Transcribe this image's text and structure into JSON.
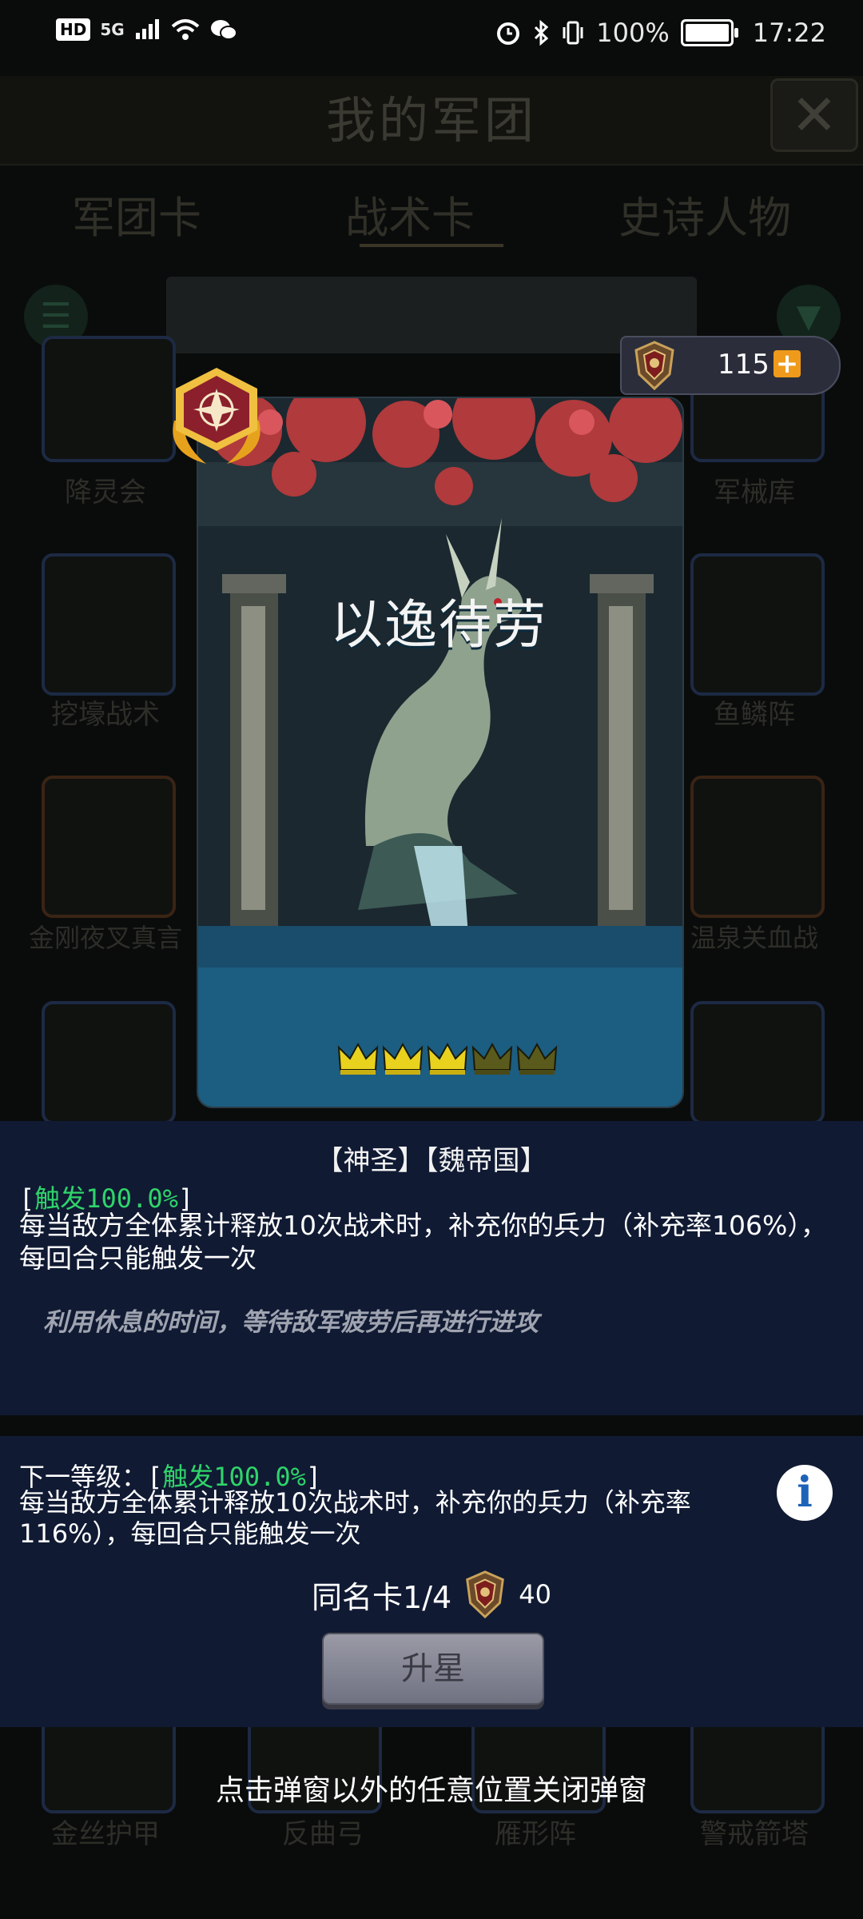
{
  "status_bar": {
    "hd": "HD",
    "network": "5G",
    "battery_pct": "100%",
    "battery_level": 1.0,
    "time": "17:22"
  },
  "background": {
    "title": "我的军团",
    "tabs": [
      "军团卡",
      "战术卡",
      "史诗人物"
    ],
    "labels": [
      "降灵会",
      "军械库",
      "挖壕战术",
      "鱼鳞阵",
      "金刚夜叉真言",
      "温泉关血战",
      "金丝护甲",
      "反曲弓",
      "雁形阵",
      "警戒箭塔"
    ]
  },
  "currency": {
    "amount": "115",
    "plus_label": "+"
  },
  "card": {
    "name": "以逸待劳",
    "stars_filled": 3,
    "stars_total": 5
  },
  "description": {
    "tags": "【神圣】【魏帝国】",
    "trigger_open": "[",
    "trigger": "触发100.0%",
    "trigger_close": "]",
    "text": "每当敌方全体累计释放10次战术时，补充你的兵力（补充率106%），每回合只能触发一次",
    "flavor": "利用休息的时间，等待敌军疲劳后再进行进攻"
  },
  "next_level": {
    "prefix": "下一等级：[",
    "trigger": "触发100.0%",
    "trigger_close": "]",
    "text": "每当敌方全体累计释放10次战术时，补充你的兵力（补充率116%），每回合只能触发一次",
    "info_icon": "i"
  },
  "duplicates": {
    "label": "同名卡1/4",
    "cost": "40"
  },
  "upgrade_button": "升星",
  "close_hint": "点击弹窗以外的任意位置关闭弹窗",
  "colors": {
    "panel": "#101a33",
    "trigger_green": "#2fd46a",
    "card_band": "#1c5d82",
    "plus_orange": "#ef9a1a"
  }
}
